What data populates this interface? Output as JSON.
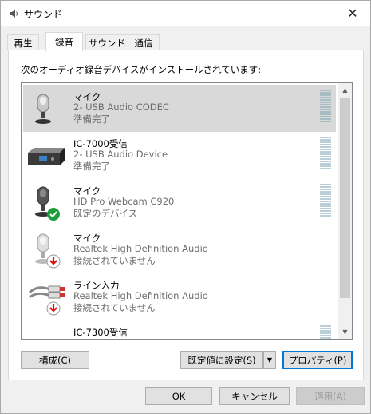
{
  "window": {
    "title": "サウンド",
    "close_symbol": "✕"
  },
  "tabs": [
    {
      "label": "再生",
      "active": false
    },
    {
      "label": "録音",
      "active": true
    },
    {
      "label": "サウンド",
      "active": false
    },
    {
      "label": "通信",
      "active": false
    }
  ],
  "panel": {
    "caption": "次のオーディオ録音デバイスがインストールされています:"
  },
  "devices": [
    {
      "name": "マイク",
      "description": "2- USB Audio CODEC",
      "status": "準備完了",
      "icon": "microphone-icon",
      "badge": null,
      "selected": true
    },
    {
      "name": "IC-7000受信",
      "description": "2- USB Audio Device",
      "status": "準備完了",
      "icon": "audio-device-box-icon",
      "badge": null,
      "selected": false
    },
    {
      "name": "マイク",
      "description": "HD Pro Webcam C920",
      "status": "既定のデバイス",
      "icon": "microphone-icon",
      "badge": "default-check-badge-icon",
      "selected": false
    },
    {
      "name": "マイク",
      "description": "Realtek High Definition Audio",
      "status": "接続されていません",
      "icon": "microphone-icon",
      "badge": "unplugged-arrow-badge-icon",
      "selected": false
    },
    {
      "name": "ライン入力",
      "description": "Realtek High Definition Audio",
      "status": "接続されていません",
      "icon": "line-in-cable-icon",
      "badge": "unplugged-arrow-badge-icon",
      "selected": false
    },
    {
      "name": "IC-7300受信",
      "description": "",
      "status": "",
      "icon": "audio-device-box-icon",
      "badge": null,
      "selected": false
    }
  ],
  "buttons": {
    "configure": "構成(C)",
    "set_default": "既定値に設定(S)",
    "properties": "プロパティ(P)",
    "ok": "OK",
    "cancel": "キャンセル",
    "apply": "適用(A)"
  },
  "colors": {
    "accent": "#0078d7",
    "selected_row": "#d9d9d9",
    "check_green": "#1f9d3a",
    "unplugged_red": "#d11"
  }
}
